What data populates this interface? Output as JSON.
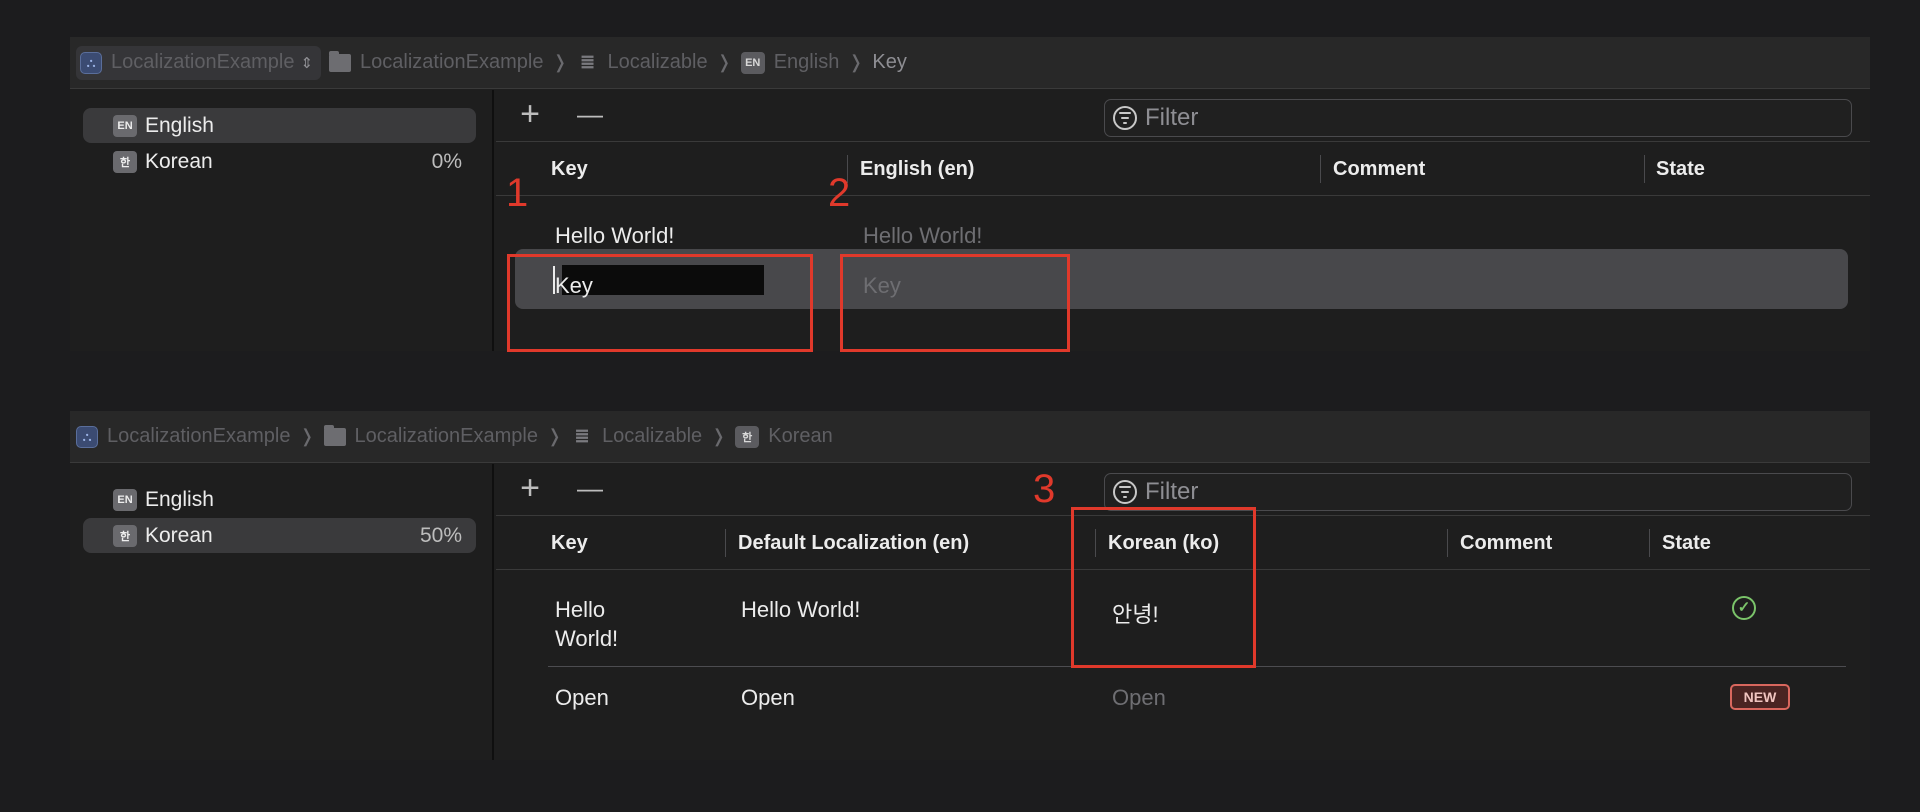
{
  "annotation_color": "#e0392b",
  "top_editor": {
    "breadcrumb": {
      "project": "LocalizationExample",
      "folder": "LocalizationExample",
      "file": "Localizable",
      "language_badge": "EN",
      "language": "English",
      "current": "Key"
    },
    "languages": [
      {
        "badge": "EN",
        "name": "English",
        "percent": ""
      },
      {
        "badge": "한",
        "name": "Korean",
        "percent": "0%"
      }
    ],
    "toolbar": {
      "add": "+",
      "remove": "—",
      "filter_placeholder": "Filter"
    },
    "columns": [
      "Key",
      "English (en)",
      "Comment",
      "State"
    ],
    "rows": [
      {
        "key": "Hello World!",
        "value": "Hello World!"
      },
      {
        "key": "Key",
        "value": "Key"
      }
    ]
  },
  "bottom_editor": {
    "breadcrumb": {
      "project": "LocalizationExample",
      "folder": "LocalizationExample",
      "file": "Localizable",
      "language_badge": "한",
      "language": "Korean"
    },
    "languages": [
      {
        "badge": "EN",
        "name": "English",
        "percent": ""
      },
      {
        "badge": "한",
        "name": "Korean",
        "percent": "50%"
      }
    ],
    "toolbar": {
      "add": "+",
      "remove": "—",
      "filter_placeholder": "Filter"
    },
    "columns": [
      "Key",
      "Default Localization (en)",
      "Korean (ko)",
      "Comment",
      "State"
    ],
    "rows": [
      {
        "key_line1": "Hello",
        "key_line2": "World!",
        "default": "Hello World!",
        "korean": "안녕!",
        "state_icon": "checkmark-circle-icon"
      },
      {
        "key": "Open",
        "default": "Open",
        "korean": "Open",
        "state": "NEW"
      }
    ]
  },
  "annotations": [
    "1",
    "2",
    "3"
  ]
}
